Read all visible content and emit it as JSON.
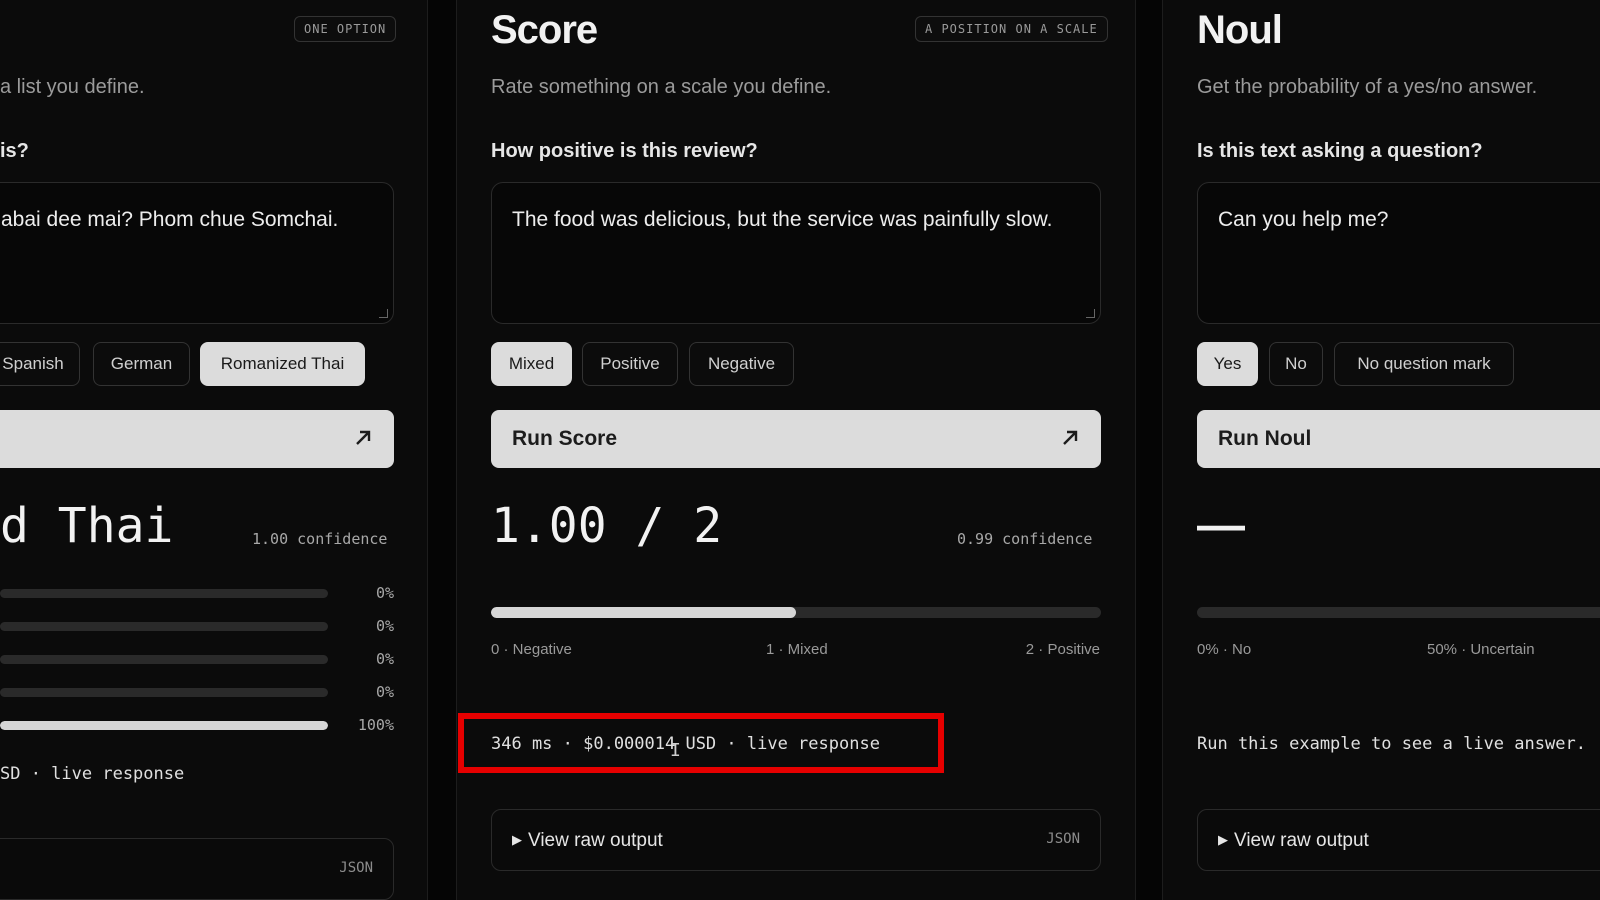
{
  "panels": {
    "left": {
      "badge": "ONE OPTION",
      "subtitle": "a list you define.",
      "question": "is?",
      "input_text": "abai dee mai? Phom chue Somchai.",
      "options": [
        {
          "label": "Spanish",
          "selected": false
        },
        {
          "label": "German",
          "selected": false
        },
        {
          "label": "Romanized Thai",
          "selected": true
        }
      ],
      "result_value": "d Thai",
      "confidence": "1.00 confidence",
      "distribution": [
        {
          "pct": "0%",
          "fraction": 0
        },
        {
          "pct": "0%",
          "fraction": 0
        },
        {
          "pct": "0%",
          "fraction": 0
        },
        {
          "pct": "0%",
          "fraction": 0
        },
        {
          "pct": "100%",
          "fraction": 1
        }
      ],
      "status": "SD · live response",
      "raw_json_tag": "JSON"
    },
    "middle": {
      "title": "Score",
      "badge": "A POSITION ON A SCALE",
      "subtitle": "Rate something on a scale you define.",
      "question": "How positive is this review?",
      "input_text": "The food was delicious, but the service was painfully slow.",
      "options": [
        {
          "label": "Mixed",
          "selected": true
        },
        {
          "label": "Positive",
          "selected": false
        },
        {
          "label": "Negative",
          "selected": false
        }
      ],
      "run_label": "Run Score",
      "result_value": "1.00 / 2",
      "confidence": "0.99 confidence",
      "scale_position": 0.5,
      "scale_labels": [
        "0 · Negative",
        "1 · Mixed",
        "2 · Positive"
      ],
      "status": "346 ms · $0.000014 USD · live response",
      "raw_output_label": "View raw output",
      "raw_json_tag": "JSON"
    },
    "right": {
      "title": "Noul",
      "subtitle": "Get the probability of a yes/no answer.",
      "question": "Is this text asking a question?",
      "input_text": "Can you help me?",
      "options": [
        {
          "label": "Yes",
          "selected": true
        },
        {
          "label": "No",
          "selected": false
        },
        {
          "label": "No question mark",
          "selected": false
        }
      ],
      "run_label": "Run Noul",
      "result_value": "—",
      "scale_labels": [
        "0% · No",
        "50% · Uncertain"
      ],
      "status": "Run this example to see a live answer.",
      "raw_output_label": "View raw output"
    }
  },
  "colors": {
    "background": "#0b0b0b",
    "selected_chip": "#dcdcdc",
    "highlight": "#e60000"
  },
  "icons": {
    "run_arrow": "arrow-up-right-icon",
    "disclosure": "triangle-right-icon",
    "text_cursor": "i-beam-cursor-icon"
  }
}
